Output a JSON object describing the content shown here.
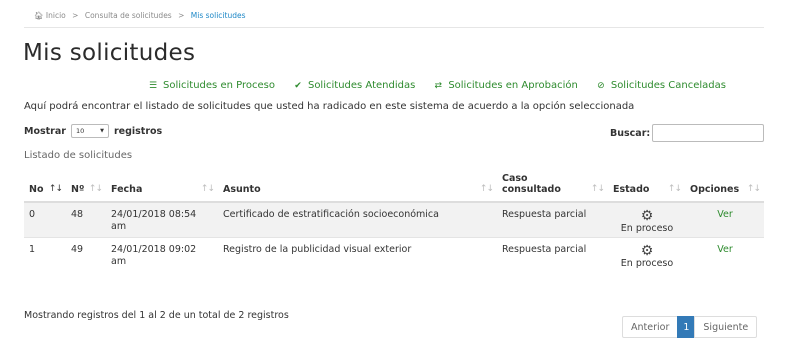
{
  "breadcrumb": {
    "home_icon": "home-icon",
    "items": [
      "Inicio",
      "Consulta de solicitudes",
      "Mis solicitudes"
    ]
  },
  "page_title": "Mis solicitudes",
  "filters": [
    {
      "label": "Solicitudes en Proceso",
      "icon": "list-icon"
    },
    {
      "label": "Solicitudes Atendidas",
      "icon": "check-icon"
    },
    {
      "label": "Solicitudes en Aprobación",
      "icon": "exchange-icon"
    },
    {
      "label": "Solicitudes Canceladas",
      "icon": "ban-icon"
    }
  ],
  "description": "Aquí podrá encontrar el listado de solicitudes que usted ha radicado en este sistema de acuerdo a la opción seleccionada",
  "length_control": {
    "prefix": "Mostrar",
    "selected": "10",
    "suffix": "registros"
  },
  "search": {
    "label": "Buscar:",
    "value": "",
    "placeholder": ""
  },
  "list_caption": "Listado de solicitudes",
  "table": {
    "columns": [
      "No",
      "Nº",
      "Fecha",
      "Asunto",
      "Caso consultado",
      "Estado",
      "Opciones"
    ],
    "rows": [
      {
        "no": "0",
        "num": "48",
        "fecha": "24/01/2018 08:54 am",
        "asunto": "Certificado de estratificación socioeconómica",
        "caso": "Respuesta parcial",
        "estado": "En proceso",
        "opcion": "Ver"
      },
      {
        "no": "1",
        "num": "49",
        "fecha": "24/01/2018 09:02 am",
        "asunto": "Registro de la publicidad visual exterior",
        "caso": "Respuesta parcial",
        "estado": "En proceso",
        "opcion": "Ver"
      }
    ]
  },
  "info_text": "Mostrando registros del 1 al 2 de un total de 2 registros",
  "pagination": {
    "prev": "Anterior",
    "current": "1",
    "next": "Siguiente"
  },
  "colors": {
    "accent_green": "#2e8b2e",
    "link_blue": "#1e88c7",
    "page_active": "#337ab7"
  }
}
